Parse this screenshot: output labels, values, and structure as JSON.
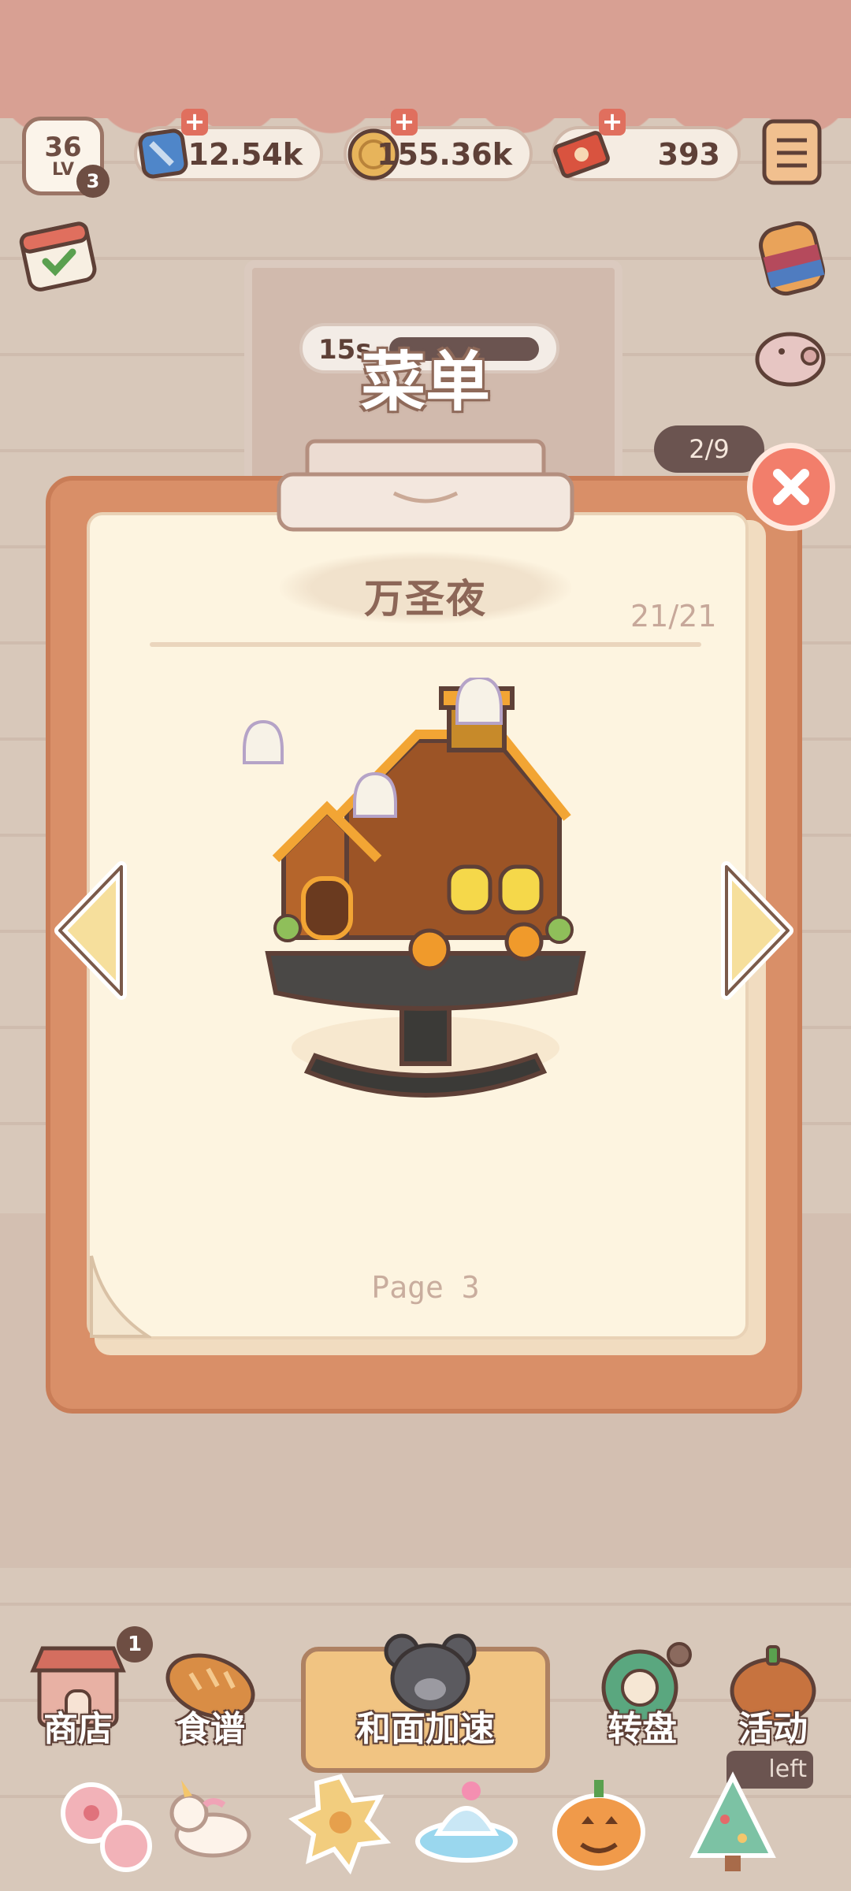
{
  "top_bar": {
    "level": {
      "value": "36",
      "label": "LV",
      "badge": "3"
    },
    "gems": "12.54k",
    "coins": "155.36k",
    "tickets": "393"
  },
  "menu": {
    "title": "菜单",
    "timer": "15s",
    "room_counter": "2/9",
    "category": "万圣夜",
    "count": "21/21",
    "page_label": "Page 3"
  },
  "bottom_nav": {
    "shop": {
      "label": "商店",
      "badge": "1"
    },
    "recipes": {
      "label": "食谱"
    },
    "speedup": {
      "label": "和面加速"
    },
    "wheel": {
      "label": "转盘"
    },
    "event": {
      "label": "活动",
      "tag": "left"
    }
  },
  "icons": {
    "top": [
      "gem-icon",
      "coin-icon",
      "ticket-icon",
      "notebook-icon"
    ],
    "side": [
      "calendar-icon",
      "jar-icon",
      "piggy-bank-icon"
    ],
    "tray": [
      "sakura-icon",
      "unicorn-icon",
      "cookie-icon",
      "ufo-icon",
      "pumpkin-icon",
      "christmas-tree-icon"
    ]
  },
  "colors": {
    "board": "#d98f68",
    "paper": "#fdf4e0",
    "close": "#f27e6b",
    "brown_text": "#8c6657"
  }
}
